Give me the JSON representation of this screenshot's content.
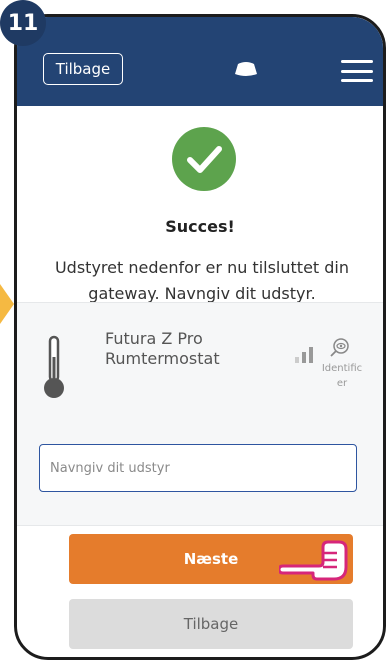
{
  "step": {
    "number": "11"
  },
  "header": {
    "back_label": "Tilbage",
    "gateway_icon": "gateway-device-icon",
    "menu_icon": "hamburger-menu-icon"
  },
  "status": {
    "icon": "check-circle-icon",
    "title": "Succes!",
    "message": "Udstyret nedenfor er nu tilsluttet din gateway. Navngiv dit udstyr."
  },
  "device": {
    "icon": "thermostat-icon",
    "name_line1": "Futura Z Pro",
    "name_line2": "Rumtermostat",
    "signal_icon": "signal-strength-icon",
    "identify_icon": "identify-eye-icon",
    "identify_line1": "Identific",
    "identify_line2": "er"
  },
  "form": {
    "name_placeholder": "Navngiv dit udstyr",
    "name_value": ""
  },
  "actions": {
    "next_label": "Næste",
    "back_label": "Tilbage"
  },
  "colors": {
    "header": "#234474",
    "success": "#5da34d",
    "next_button": "#e57c2c",
    "back_button": "#dcdcdc",
    "badge": "#1f3a63",
    "accent_arrow": "#f5b942",
    "pointer": "#d6267a"
  }
}
